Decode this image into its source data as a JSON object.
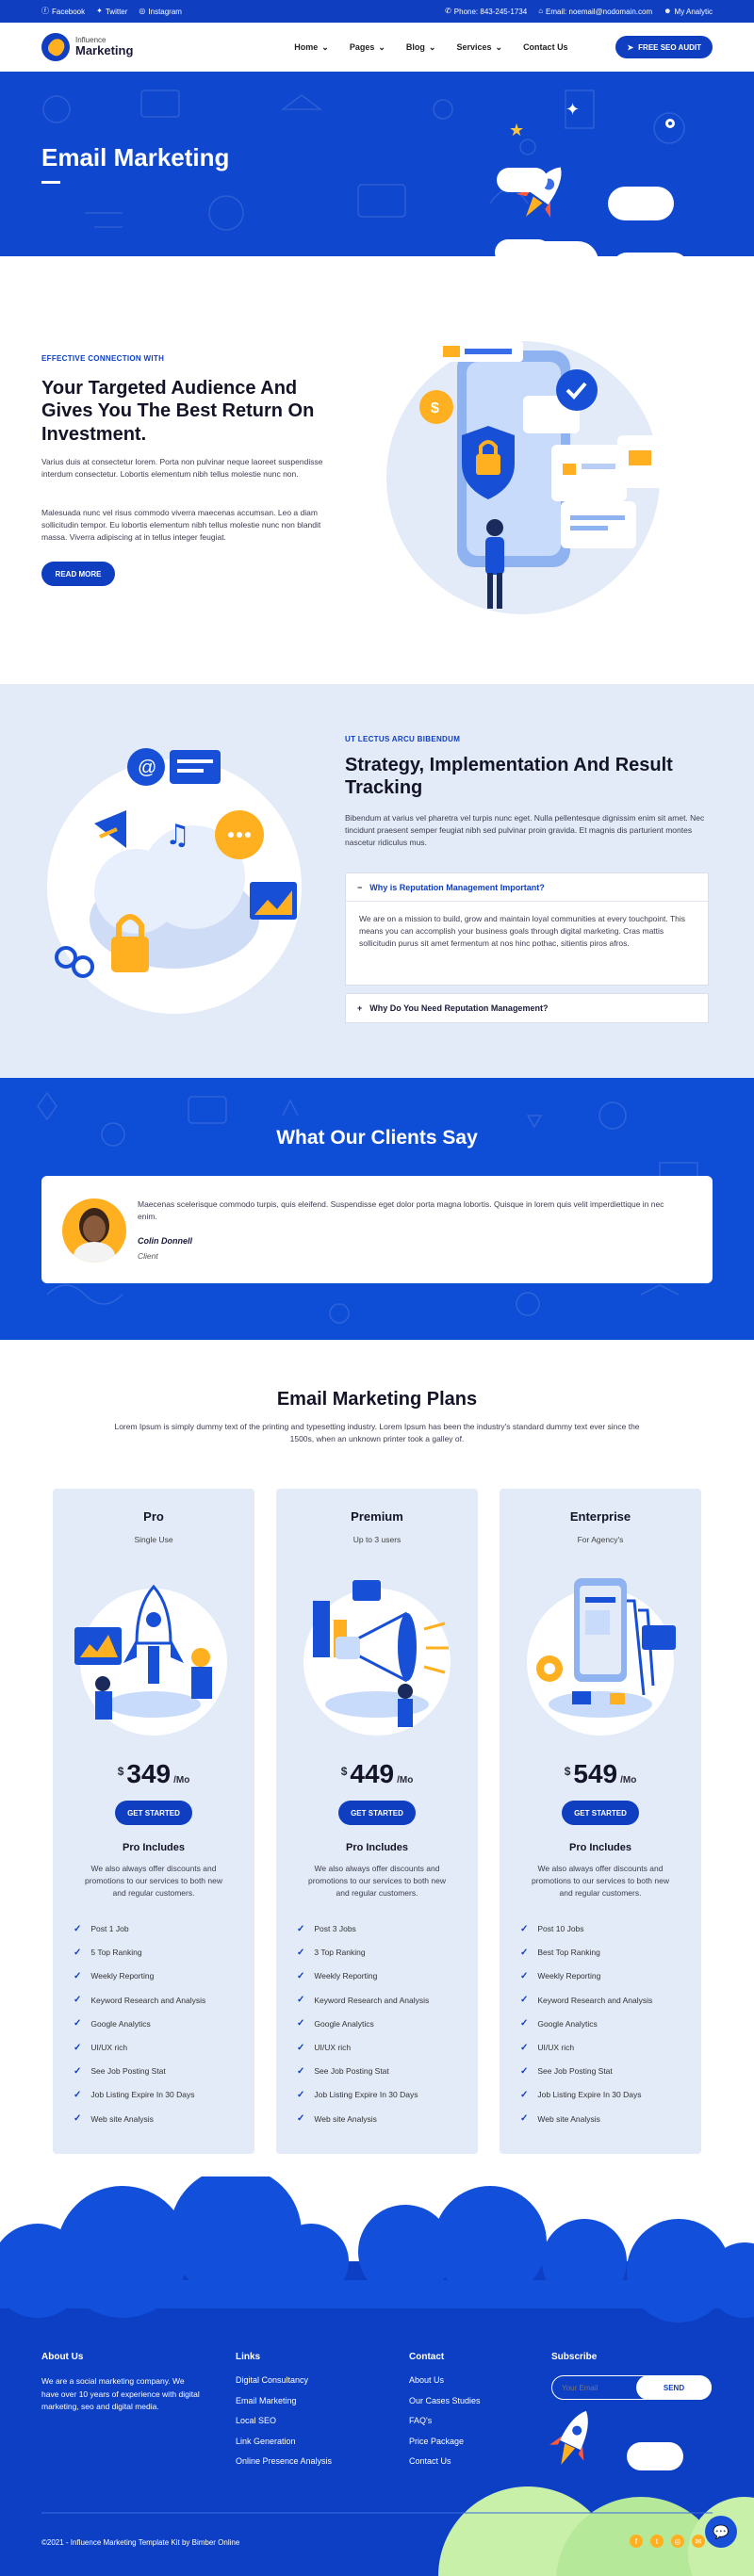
{
  "topbar": {
    "facebook": "Facebook",
    "twitter": "Twitter",
    "instagram": "Instagram",
    "phone": "Phone: 843-245-1734",
    "email": "Email: noemail@nodomain.com",
    "account": "My Analytic"
  },
  "nav": {
    "logo_small": "Influence",
    "logo_big": "Marketing",
    "items": [
      "Home",
      "Pages",
      "Blog",
      "Services",
      "Contact Us"
    ],
    "cta": "FREE SEO AUDIT"
  },
  "hero": {
    "title": "Email Marketing"
  },
  "section1": {
    "eyebrow": "EFFECTIVE CONNECTION WITH",
    "heading": "Your Targeted Audience And Gives You The Best Return On Investment.",
    "para1": "Varius duis at consectetur lorem. Porta non pulvinar neque laoreet suspendisse interdum consectetur. Lobortis elementum nibh tellus molestie nunc non.",
    "para2": "Malesuada nunc vel risus commodo viverra maecenas accumsan. Leo a diam sollicitudin tempor. Eu lobortis elementum nibh tellus molestie nunc non blandit massa. Viverra adipiscing at in tellus integer feugiat.",
    "button": "READ MORE"
  },
  "section2": {
    "eyebrow": "UT LECTUS ARCU BIBENDUM",
    "heading": "Strategy, Implementation And Result Tracking",
    "para": "Bibendum at varius vel pharetra vel turpis nunc eget. Nulla pellentesque dignissim enim sit amet. Nec tincidunt praesent semper feugiat nibh sed pulvinar proin gravida. Et magnis dis parturient montes nascetur ridiculus mus.",
    "accordion": [
      {
        "q": "Why is Reputation Management Important?",
        "a": "We are on a mission to build, grow and maintain loyal communities at every touchpoint. This means you can accomplish your business goals through digital marketing. Cras mattis sollicitudin purus sit amet fermentum at nos hinc pothac, sitientis piros afros.",
        "open": true
      },
      {
        "q": "Why Do You Need Reputation Management?",
        "open": false
      }
    ]
  },
  "testimonials": {
    "title": "What Our Clients Say",
    "quote": "Maecenas scelerisque commodo turpis, quis eleifend. Suspendisse eget dolor porta magna lobortis. Quisque in lorem quis velit imperdiettique in nec enim.",
    "name": "Colin Donnell",
    "role": "Client"
  },
  "plans": {
    "title": "Email Marketing Plans",
    "subtitle": "Lorem Ipsum is simply dummy text of the printing and typesetting industry. Lorem Ipsum has been the industry's standard dummy text ever since the 1500s, when an unknown printer took a galley of.",
    "cards": [
      {
        "name": "Pro",
        "sub": "Single Use",
        "currency": "$",
        "price": "349",
        "period": "/Mo",
        "button": "GET STARTED",
        "includes": "Pro Includes",
        "desc": "We also always offer discounts and promotions to our services to both new and regular customers.",
        "features": [
          "Post 1 Job",
          "5 Top Ranking",
          "Weekly Reporting",
          "Keyword Research and Analysis",
          "Google Analytics",
          "UI/UX rich",
          "See Job Posting Stat",
          "Job Listing Expire In 30 Days",
          "Web site Analysis"
        ]
      },
      {
        "name": "Premium",
        "sub": "Up to 3 users",
        "currency": "$",
        "price": "449",
        "period": "/Mo",
        "button": "GET STARTED",
        "includes": "Pro Includes",
        "desc": "We also always offer discounts and promotions to our services to both new and regular customers.",
        "features": [
          "Post 3 Jobs",
          "3 Top Ranking",
          "Weekly Reporting",
          "Keyword Research and Analysis",
          "Google Analytics",
          "UI/UX rich",
          "See Job Posting Stat",
          "Job Listing Expire In 30 Days",
          "Web site Analysis"
        ]
      },
      {
        "name": "Enterprise",
        "sub": "For Agency's",
        "currency": "$",
        "price": "549",
        "period": "/Mo",
        "button": "GET STARTED",
        "includes": "Pro Includes",
        "desc": "We also always offer discounts and promotions to our services to both new and regular customers.",
        "features": [
          "Post 10 Jobs",
          "Best Top Ranking",
          "Weekly Reporting",
          "Keyword Research and Analysis",
          "Google Analytics",
          "UI/UX rich",
          "See Job Posting Stat",
          "Job Listing Expire In 30 Days",
          "Web site Analysis"
        ]
      }
    ]
  },
  "footer": {
    "about_title": "About Us",
    "about_text": "We are a social marketing company. We have over 10 years of experience with digital marketing, seo and digital media.",
    "links_title": "Links",
    "links": [
      "Digital Consultancy",
      "Email Marketing",
      "Local SEO",
      "Link Generation",
      "Online Presence Analysis"
    ],
    "contact_title": "Contact",
    "contact": [
      "About Us",
      "Our Cases Studies",
      "FAQ's",
      "Price Package",
      "Contact Us"
    ],
    "subscribe_title": "Subscribe",
    "email_placeholder": "Your Email",
    "send": "SEND",
    "copyright": "©2021 - Influence Marketing Template Kit by Bimber Online"
  },
  "colors": {
    "primary": "#0f3fc0",
    "hero_bg": "#0f48cf",
    "light_bg": "#e3ebf8",
    "dark_text": "#141428",
    "accent": "#ffb020"
  }
}
